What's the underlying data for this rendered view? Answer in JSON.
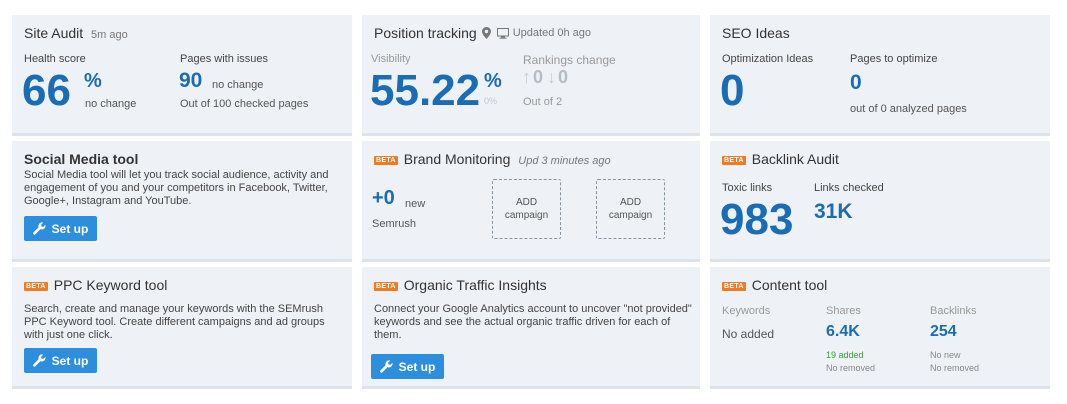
{
  "site_audit": {
    "title": "Site Audit",
    "timestamp": "5m ago",
    "health_label": "Health score",
    "health_value": "66",
    "health_unit": "%",
    "health_change": "no change",
    "pages_label": "Pages with issues",
    "pages_value": "90",
    "pages_change": "no change",
    "pages_sub": "Out of 100 checked pages"
  },
  "position_tracking": {
    "title": "Position tracking",
    "updated": "Updated 0h ago",
    "visibility_label": "Visibility",
    "visibility_value": "55.22",
    "visibility_unit": "%",
    "visibility_change": "0%",
    "rankings_label": "Rankings change",
    "rank_up": "0",
    "rank_down": "0",
    "rankings_sub": "Out of 2"
  },
  "seo_ideas": {
    "title": "SEO Ideas",
    "opt_label": "Optimization Ideas",
    "opt_value": "0",
    "pages_label": "Pages to optimize",
    "pages_value": "0",
    "pages_sub": "out of 0 analyzed pages"
  },
  "social_media": {
    "title": "Social Media tool",
    "description": "Social Media tool will let you track social audience, activity and engagement of you and your competitors in Facebook, Twitter, Google+, Instagram and YouTube.",
    "button": "Set up"
  },
  "brand_monitoring": {
    "beta": "BETA",
    "title": "Brand Monitoring",
    "updated": "Upd 3 minutes ago",
    "count": "+0",
    "count_label": "new",
    "source": "Semrush",
    "add_line1": "ADD",
    "add_line2": "campaign"
  },
  "backlink_audit": {
    "beta": "BETA",
    "title": "Backlink Audit",
    "toxic_label": "Toxic links",
    "toxic_value": "983",
    "checked_label": "Links checked",
    "checked_value": "31K"
  },
  "ppc_keyword": {
    "beta": "BETA",
    "title": "PPC Keyword tool",
    "description": "Search, create and manage your keywords with the SEMrush PPC Keyword tool. Create different campaigns and ad groups with just one click.",
    "button": "Set up"
  },
  "organic_traffic": {
    "beta": "BETA",
    "title": "Organic Traffic Insights",
    "description": "Connect your Google Analytics account to uncover \"not provided\" keywords and see the actual organic traffic driven for each of them.",
    "button": "Set up"
  },
  "content_tool": {
    "beta": "BETA",
    "title": "Content tool",
    "keywords_label": "Keywords",
    "keywords_value": "No added",
    "shares_label": "Shares",
    "shares_value": "6.4K",
    "shares_added": "19 added",
    "shares_removed": "No removed",
    "backlinks_label": "Backlinks",
    "backlinks_value": "254",
    "backlinks_new": "No new",
    "backlinks_removed": "No removed"
  },
  "colors": {
    "accent_blue": "#1a6cb4",
    "button_blue": "#2d8ede",
    "beta_orange": "#f47a20",
    "card_bg": "#eef2f6"
  }
}
